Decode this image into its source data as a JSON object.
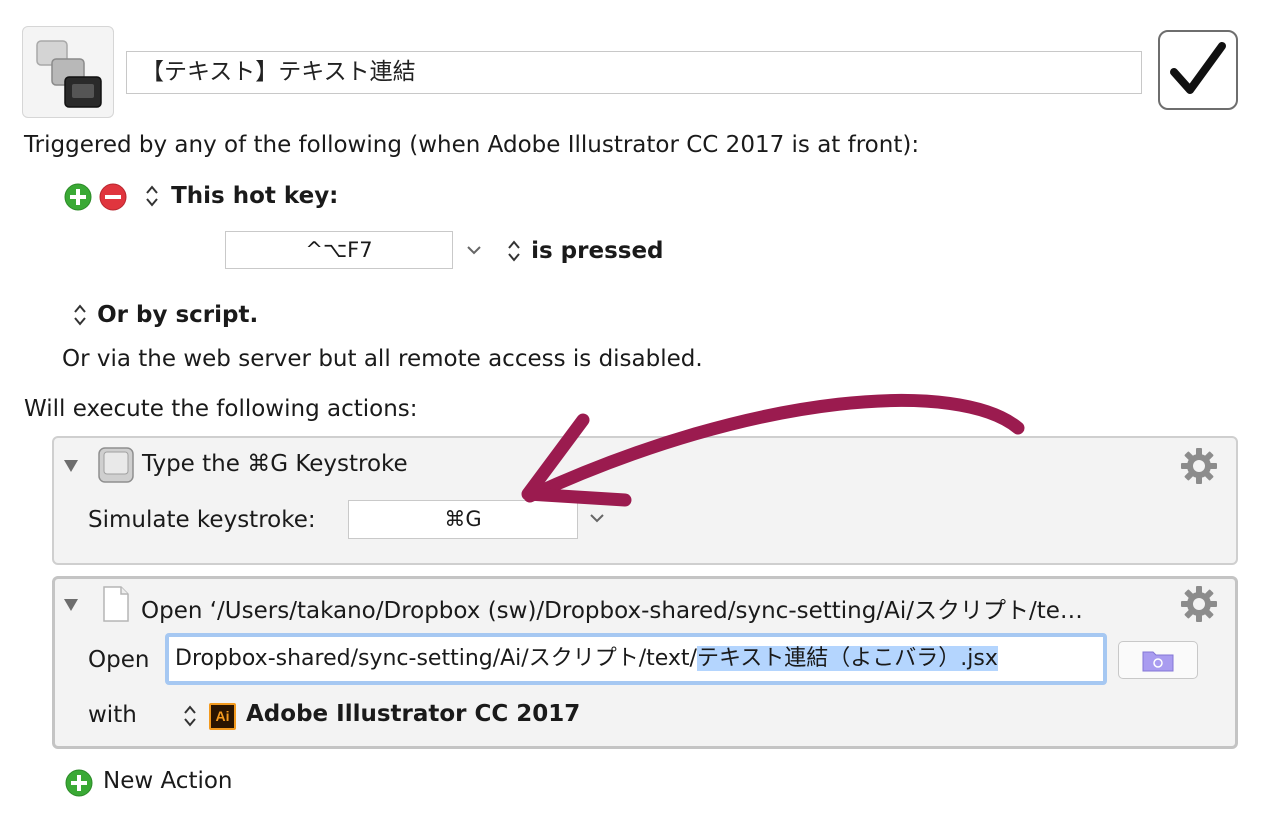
{
  "macro": {
    "name": "【テキスト】テキスト連結",
    "icon": "keyboard-keys-icon",
    "enabled_icon": "checkmark-icon"
  },
  "trigger": {
    "header": "Triggered by any of the following (when Adobe Illustrator CC 2017 is at front):",
    "hotkey_label": "This hot key:",
    "hotkey_value": "^⌥F7",
    "hotkey_condition": "is pressed",
    "script_label": "Or by script.",
    "web_server_text": "Or via the web server but all remote access is disabled."
  },
  "actions": {
    "header": "Will execute the following actions:",
    "keystroke": {
      "title": "Type the ⌘G Keystroke",
      "simulate_label": "Simulate keystroke:",
      "keystroke_value": "⌘G"
    },
    "open": {
      "title": "Open ‘/Users/takano/Dropbox (sw)/Dropbox-shared/sync-setting/Ai/スクリプト/te…",
      "open_label": "Open",
      "path_plain": "Dropbox-shared/sync-setting/Ai/スクリプト/text/",
      "path_selected": "テキスト連結（よこバラ）.jsx",
      "with_label": "with",
      "app_icon_text": "Ai",
      "app_name": "Adobe Illustrator CC 2017"
    },
    "new_action_label": "New Action"
  },
  "colors": {
    "annotation_arrow": "#9b1b4f",
    "add_green": "#3aa935",
    "remove_red": "#e0353e",
    "selection": "#b4d5fe",
    "focus_ring": "#a6c8f2"
  }
}
